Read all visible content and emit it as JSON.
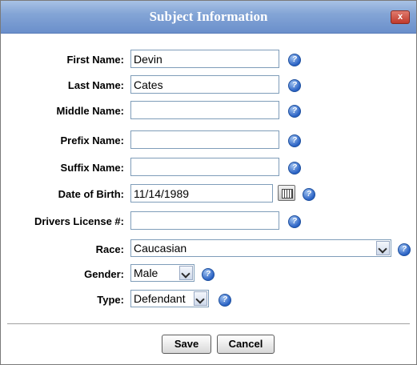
{
  "dialog": {
    "title": "Subject Information",
    "close_label": "x"
  },
  "form": {
    "first_name": {
      "label": "First Name:",
      "value": "Devin"
    },
    "last_name": {
      "label": "Last Name:",
      "value": "Cates"
    },
    "middle_name": {
      "label": "Middle Name:",
      "value": ""
    },
    "prefix_name": {
      "label": "Prefix Name:",
      "value": ""
    },
    "suffix_name": {
      "label": "Suffix Name:",
      "value": ""
    },
    "date_of_birth": {
      "label": "Date of Birth:",
      "value": "11/14/1989"
    },
    "drivers_license": {
      "label": "Drivers License #:",
      "value": ""
    },
    "race": {
      "label": "Race:",
      "value": "Caucasian"
    },
    "gender": {
      "label": "Gender:",
      "value": "Male"
    },
    "type": {
      "label": "Type:",
      "value": "Defendant"
    }
  },
  "help_glyph": "?",
  "buttons": {
    "save": "Save",
    "cancel": "Cancel"
  },
  "colors": {
    "titlebar": "#6a8fcb",
    "help_icon": "#2a62c4",
    "close_button": "#c0392b"
  }
}
